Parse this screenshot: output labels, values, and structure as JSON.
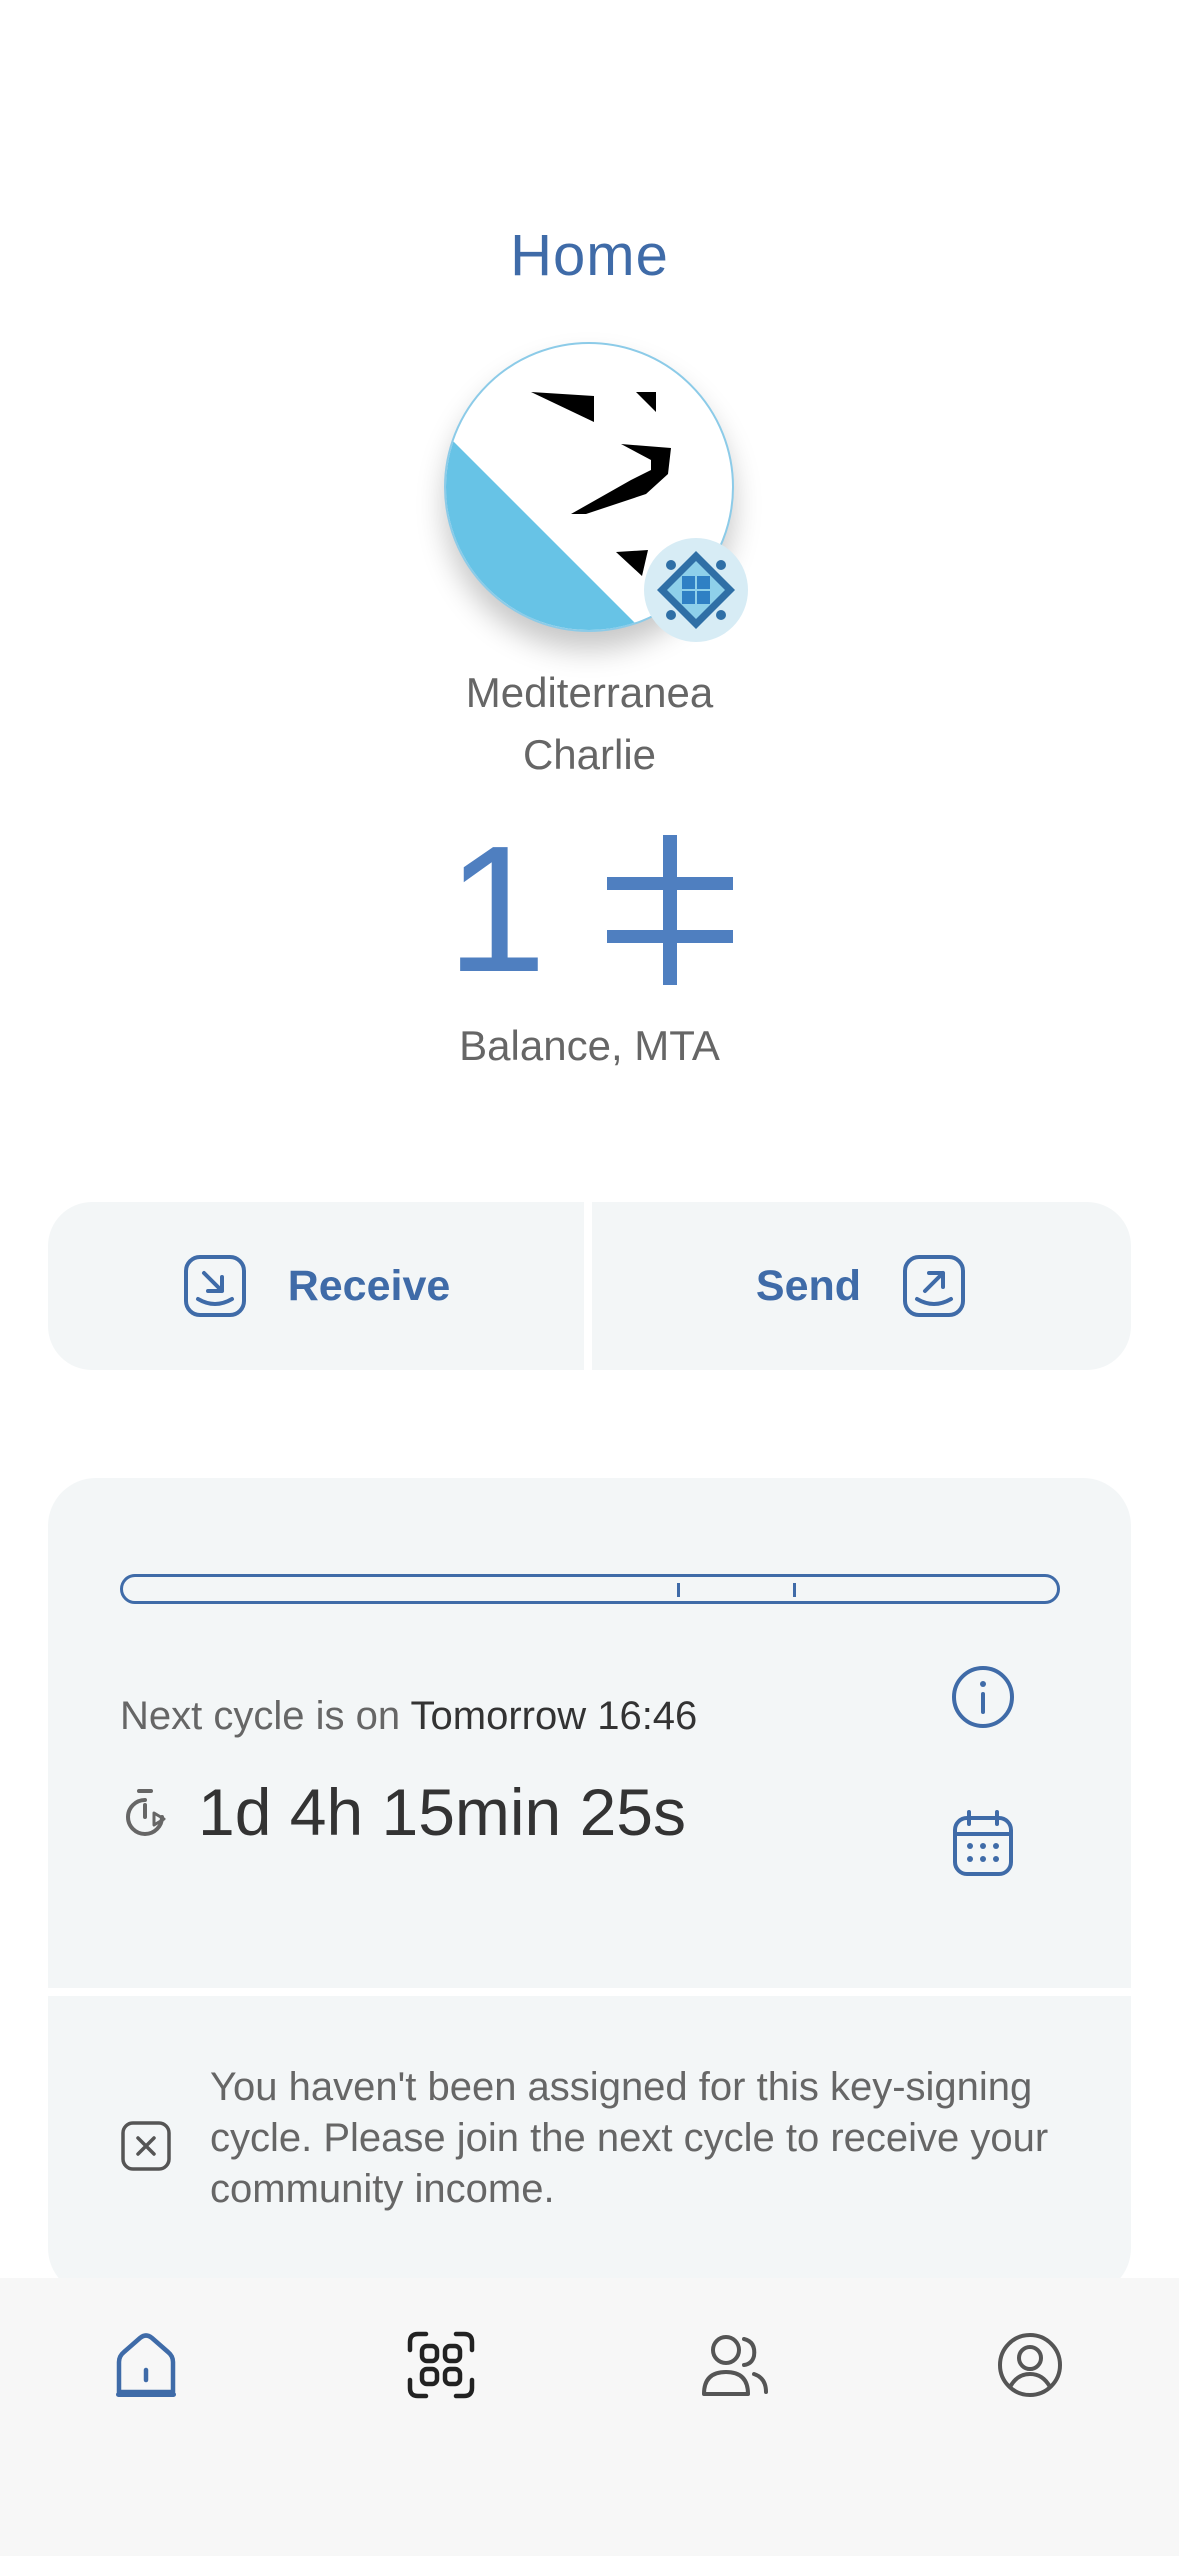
{
  "header": {
    "title": "Home"
  },
  "profile": {
    "community_name": "Mediterranea",
    "user_name": "Charlie",
    "avatar_icon": "lion-logo-icon",
    "badge_icon": "community-badge-icon"
  },
  "balance": {
    "amount": "1",
    "currency_icon": "mta-currency-icon",
    "label": "Balance, MTA"
  },
  "actions": {
    "receive_label": "Receive",
    "send_label": "Send"
  },
  "cycle": {
    "progress_ticks": 2,
    "next_cycle_prefix": "Next cycle is on",
    "next_cycle_time": "Tomorrow 16:46",
    "countdown": "1d 4h 15min 25s"
  },
  "notice": {
    "text": "You haven't been assigned for this key-signing cycle. Please join the next cycle to receive your community income."
  },
  "tabbar": {
    "items": [
      {
        "name": "home",
        "icon": "home-icon",
        "active": true
      },
      {
        "name": "scan",
        "icon": "qr-scan-icon",
        "active": false
      },
      {
        "name": "contacts",
        "icon": "contacts-icon",
        "active": false
      },
      {
        "name": "profile",
        "icon": "profile-icon",
        "active": false
      }
    ]
  },
  "colors": {
    "accent": "#3f6ba8",
    "balance": "#4f7fc0",
    "card": "#f3f6f7",
    "avatar_blue": "#67c3e6"
  }
}
